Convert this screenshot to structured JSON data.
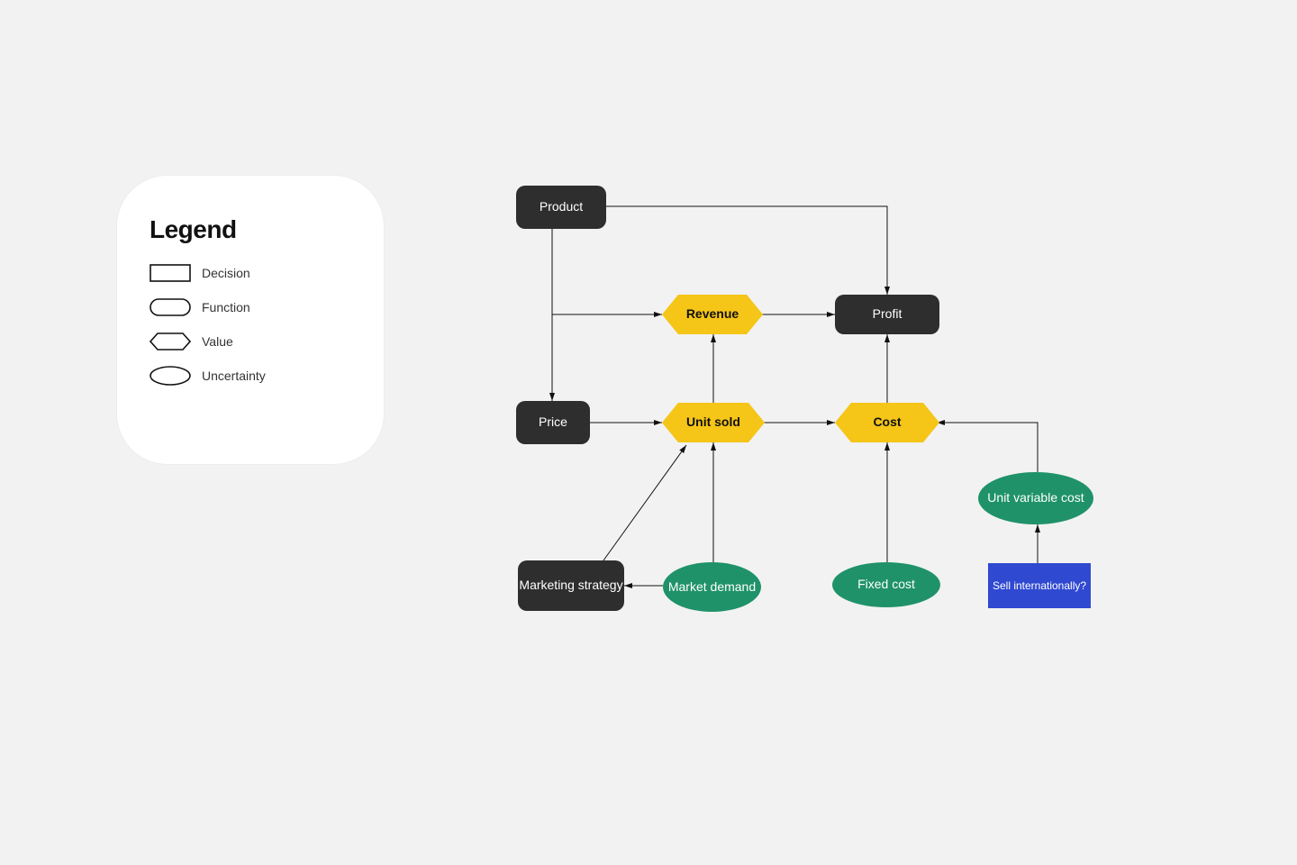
{
  "legend": {
    "title": "Legend",
    "items": {
      "decision": "Decision",
      "function": "Function",
      "value": "Value",
      "uncertainty": "Uncertainty"
    }
  },
  "nodes": {
    "product": "Product",
    "profit": "Profit",
    "price": "Price",
    "revenue": "Revenue",
    "unit_sold": "Unit sold",
    "cost": "Cost",
    "marketing_strategy": "Marketing strategy",
    "market_demand": "Market demand",
    "fixed_cost": "Fixed cost",
    "unit_variable_cost": "Unit variable cost",
    "sell_internationally": "Sell internationally?"
  }
}
